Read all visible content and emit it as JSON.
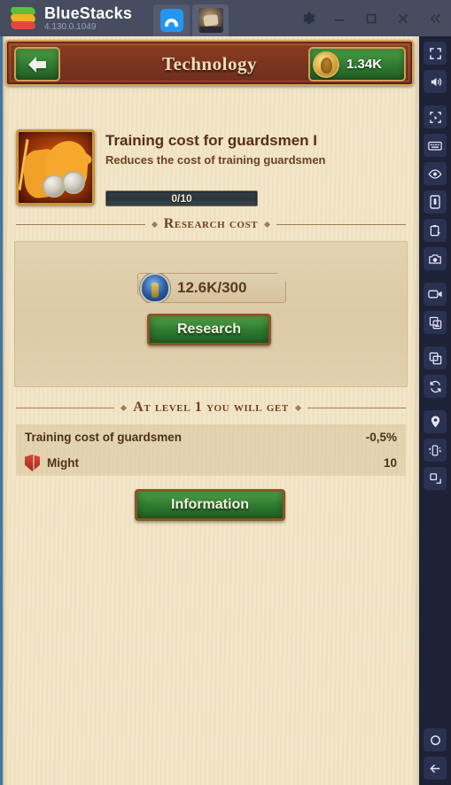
{
  "titlebar": {
    "app_name": "BlueStacks",
    "version": "4.130.0.1049",
    "tabs": [
      {
        "name": "home-tab",
        "icon": "home-icon",
        "active": false
      },
      {
        "name": "game-tab",
        "icon": "game-thumbnail-icon",
        "active": true
      }
    ],
    "window_buttons": [
      {
        "name": "settings-button",
        "icon": "gear-icon"
      },
      {
        "name": "minimize-button",
        "icon": "minimize-icon"
      },
      {
        "name": "maximize-button",
        "icon": "maximize-icon"
      },
      {
        "name": "close-button",
        "icon": "close-icon"
      },
      {
        "name": "collapse-sidebar-button",
        "icon": "chevron-double-left-icon"
      }
    ]
  },
  "sidebar": {
    "items": [
      {
        "name": "fullscreen-button",
        "icon": "fullscreen-icon"
      },
      {
        "name": "volume-button",
        "icon": "speaker-icon"
      },
      {
        "name": "multi-instance-button",
        "icon": "crop-corners-icon"
      },
      {
        "name": "keymapping-button",
        "icon": "keyboard-icon"
      },
      {
        "name": "eye-button",
        "icon": "eye-icon"
      },
      {
        "name": "rotate-screen-button",
        "icon": "phone-icon"
      },
      {
        "name": "macro-recorder-button",
        "icon": "clipboard-play-icon"
      },
      {
        "name": "screenshot-button",
        "icon": "camera-icon"
      },
      {
        "name": "screen-record-button",
        "icon": "video-camera-icon"
      },
      {
        "name": "media-manager-button",
        "icon": "image-stack-icon"
      },
      {
        "name": "multi-window-button",
        "icon": "copy-icon"
      },
      {
        "name": "sync-button",
        "icon": "refresh-icon"
      },
      {
        "name": "location-button",
        "icon": "map-pin-icon"
      },
      {
        "name": "shake-button",
        "icon": "shake-device-icon"
      },
      {
        "name": "resize-button",
        "icon": "resize-corner-icon"
      }
    ],
    "bottom_items": [
      {
        "name": "home-nav-button",
        "icon": "circle-icon"
      },
      {
        "name": "back-nav-button",
        "icon": "arrow-left-icon"
      }
    ]
  },
  "game": {
    "header": {
      "title": "Technology",
      "back_button_icon": "arrow-left-icon",
      "currency": {
        "icon": "gold-coin-icon",
        "value": "1.34K"
      }
    },
    "technology": {
      "icon": "cavalry-coins-icon",
      "title": "Training cost for guardsmen I",
      "description": "Reduces the cost of training guardsmen",
      "progress_label": "0/10",
      "progress_current": 0,
      "progress_max": 10
    },
    "research_section": {
      "heading": "Research cost",
      "cost_icon": "blue-helmet-icon",
      "cost_value": "12.6K/300",
      "research_button": "Research"
    },
    "level_section": {
      "heading": "At level 1 you will get",
      "bonuses": [
        {
          "icon": null,
          "name": "Training cost of guardsmen",
          "value": "-0,5%"
        },
        {
          "icon": "red-shield-icon",
          "name": "Might",
          "value": "10"
        }
      ],
      "information_button": "Information"
    }
  },
  "colors": {
    "parchment": "#f3e6c8",
    "header_brown": "#7d3620",
    "gold_border": "#d8a05a",
    "green_button": "#2f7c32",
    "title_text": "#f2ddb8",
    "body_text": "#5a2d17",
    "sidebar_bg": "#1d2236",
    "titlebar_bg": "#464d60"
  }
}
